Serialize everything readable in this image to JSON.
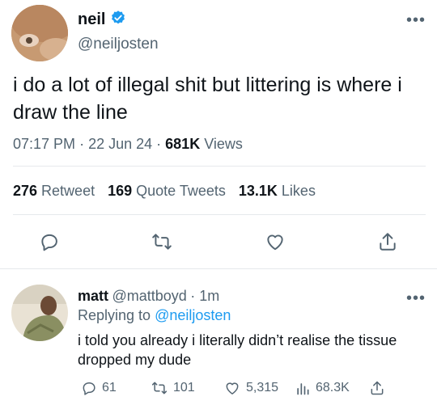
{
  "tweet": {
    "name": "neil",
    "handle": "@neiljosten",
    "text": "i do a lot of illegal shit but littering is where i draw the line",
    "time": "07:17 PM",
    "date": "22 Jun 24",
    "views_count": "681K",
    "views_label": "Views",
    "retweets_count": "276",
    "retweets_label": "Retweet",
    "quotes_count": "169",
    "quotes_label": "Quote Tweets",
    "likes_count": "13.1K",
    "likes_label": "Likes"
  },
  "reply": {
    "name": "matt",
    "handle": "@mattboyd",
    "time": "1m",
    "replying_prefix": "Replying to",
    "replying_handle": "@neiljosten",
    "text": "i told you already i literally didn’t realise the tissue dropped my dude",
    "replies": "61",
    "retweets": "101",
    "likes": "5,315",
    "views": "68.3K"
  },
  "colors": {
    "accent": "#1d9bf0",
    "muted": "#536471",
    "text": "#0f1419",
    "divider": "#e6e9ec"
  },
  "icons": [
    "verified-badge-icon",
    "more-icon",
    "reply-icon",
    "retweet-icon",
    "like-icon",
    "share-icon",
    "views-icon"
  ]
}
